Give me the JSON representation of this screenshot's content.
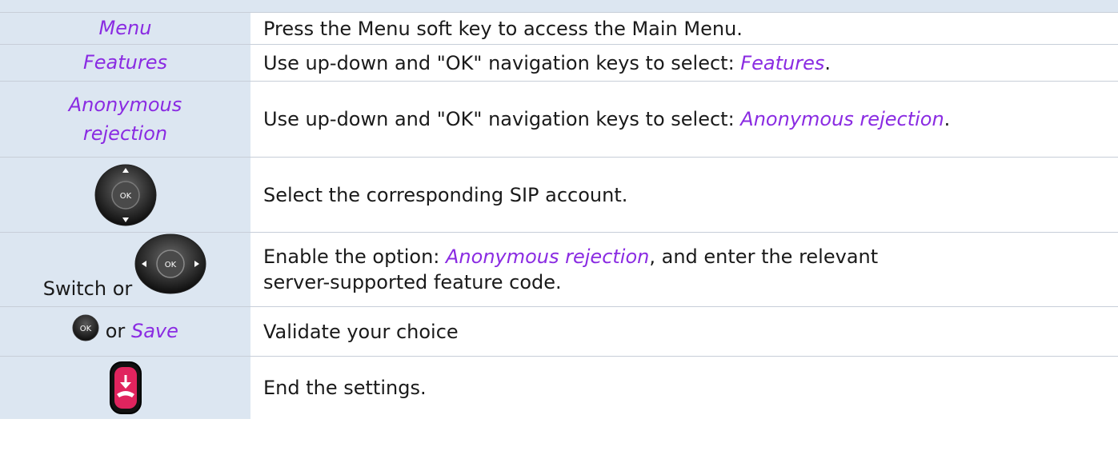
{
  "rows": [
    {
      "left": "Menu",
      "right": "Press the Menu soft key to access the Main Menu."
    },
    {
      "left": "Features",
      "right_prefix": "Use up-down and \"OK\" navigation keys to select: ",
      "right_em": "Features",
      "right_suffix": "."
    },
    {
      "left_line1": "Anonymous",
      "left_line2": "rejection",
      "right_prefix": "Use up-down and \"OK\" navigation keys to select: ",
      "right_em": "Anonymous rejection",
      "right_suffix": "."
    },
    {
      "left_icon": "ok-navigation-key-up-down-icon",
      "right": "Select the corresponding SIP account."
    },
    {
      "left_text": "Switch or",
      "left_icon": "ok-navigation-key-left-right-icon",
      "right_line1_prefix": "Enable the option: ",
      "right_line1_em": "Anonymous rejection",
      "right_line1_suffix": ", and enter the relevant",
      "right_line2": "server-supported feature code."
    },
    {
      "left_icon": "ok-key-icon",
      "left_or": "or",
      "left_em": "Save",
      "right": "Validate your choice"
    },
    {
      "left_icon": "end-call-key-icon",
      "right": "End the settings."
    }
  ],
  "icon_labels": {
    "ok": "OK"
  },
  "colors": {
    "left_bg": "#dce6f1",
    "accent": "#8a2be2",
    "border": "#c7ced8"
  }
}
